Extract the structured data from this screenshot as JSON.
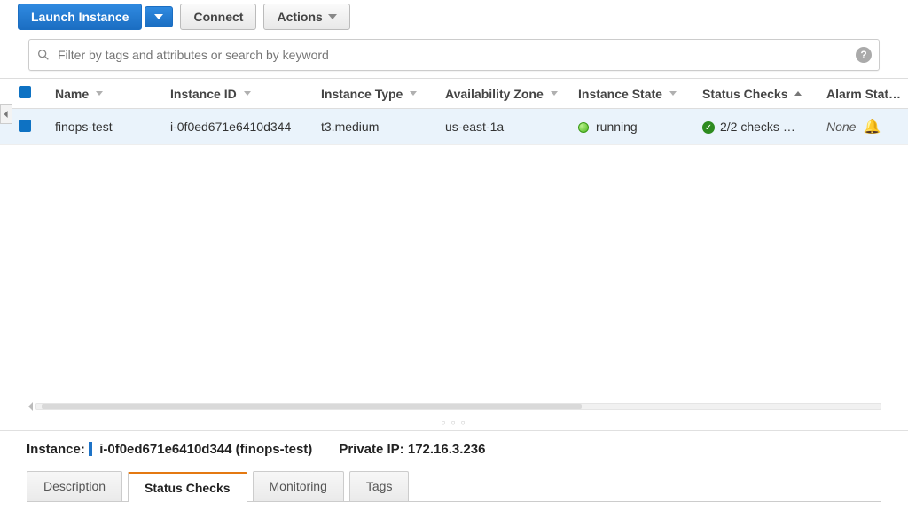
{
  "toolbar": {
    "launch_label": "Launch Instance",
    "connect_label": "Connect",
    "actions_label": "Actions"
  },
  "filter": {
    "placeholder": "Filter by tags and attributes or search by keyword"
  },
  "columns": {
    "name": "Name",
    "instance_id": "Instance ID",
    "instance_type": "Instance Type",
    "az": "Availability Zone",
    "state": "Instance State",
    "status_checks": "Status Checks",
    "alarm_status": "Alarm Status"
  },
  "rows": [
    {
      "name": "finops-test",
      "instance_id": "i-0f0ed671e6410d344",
      "instance_type": "t3.medium",
      "az": "us-east-1a",
      "state": "running",
      "status_checks": "2/2 checks …",
      "alarm_status": "None"
    }
  ],
  "details": {
    "instance_label": "Instance:",
    "instance_value": "i-0f0ed671e6410d344 (finops-test)",
    "private_ip_label": "Private IP:",
    "private_ip_value": "172.16.3.236",
    "tabs": {
      "description": "Description",
      "status_checks": "Status Checks",
      "monitoring": "Monitoring",
      "tags": "Tags"
    }
  }
}
